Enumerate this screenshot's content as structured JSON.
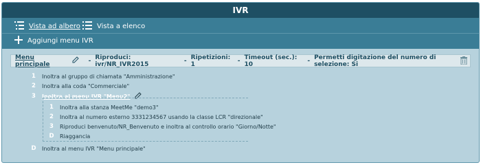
{
  "window": {
    "title": "IVR"
  },
  "toolbar": {
    "tree_view_label": "Vista ad albero",
    "list_view_label": "Vista a elenco",
    "add_menu_label": "Aggiungi menu IVR"
  },
  "main_menu": {
    "name": "Menu principale",
    "sep": "-",
    "play": "Riproduci: ivr/NR_IVR2015",
    "repeats": "Ripetizioni: 1",
    "timeout": "Timeout (sec.): 10",
    "permit": "Permetti digitazione del numero di selezione: Si",
    "items": [
      {
        "key": "1",
        "text": "Inoltra al gruppo di chiamata \"Amministrazione\""
      },
      {
        "key": "2",
        "text": "Inoltra alla coda \"Commerciale\""
      },
      {
        "key": "3",
        "text": "Inoltra al menu IVR \"Menu2\""
      },
      {
        "key": "D",
        "text": "Inoltra al menu IVR \"Menu principale\""
      }
    ]
  },
  "submenu": {
    "items": [
      {
        "key": "1",
        "text": "Inoltra alla stanza MeetMe \"demo3\""
      },
      {
        "key": "2",
        "text": "Inoltra al numero esterno 3331234567 usando la classe LCR \"direzionale\""
      },
      {
        "key": "3",
        "text": "Riproduci benvenuto/NR_Benvenuto e inoltra al controllo orario \"Giorno/Notte\""
      },
      {
        "key": "D",
        "text": "Riaggancia"
      }
    ]
  },
  "colors": {
    "title_bar": "#1e4f63",
    "toolbar": "#3a7d96",
    "panel": "#b7d2dd",
    "header_row": "#dde8ec"
  }
}
